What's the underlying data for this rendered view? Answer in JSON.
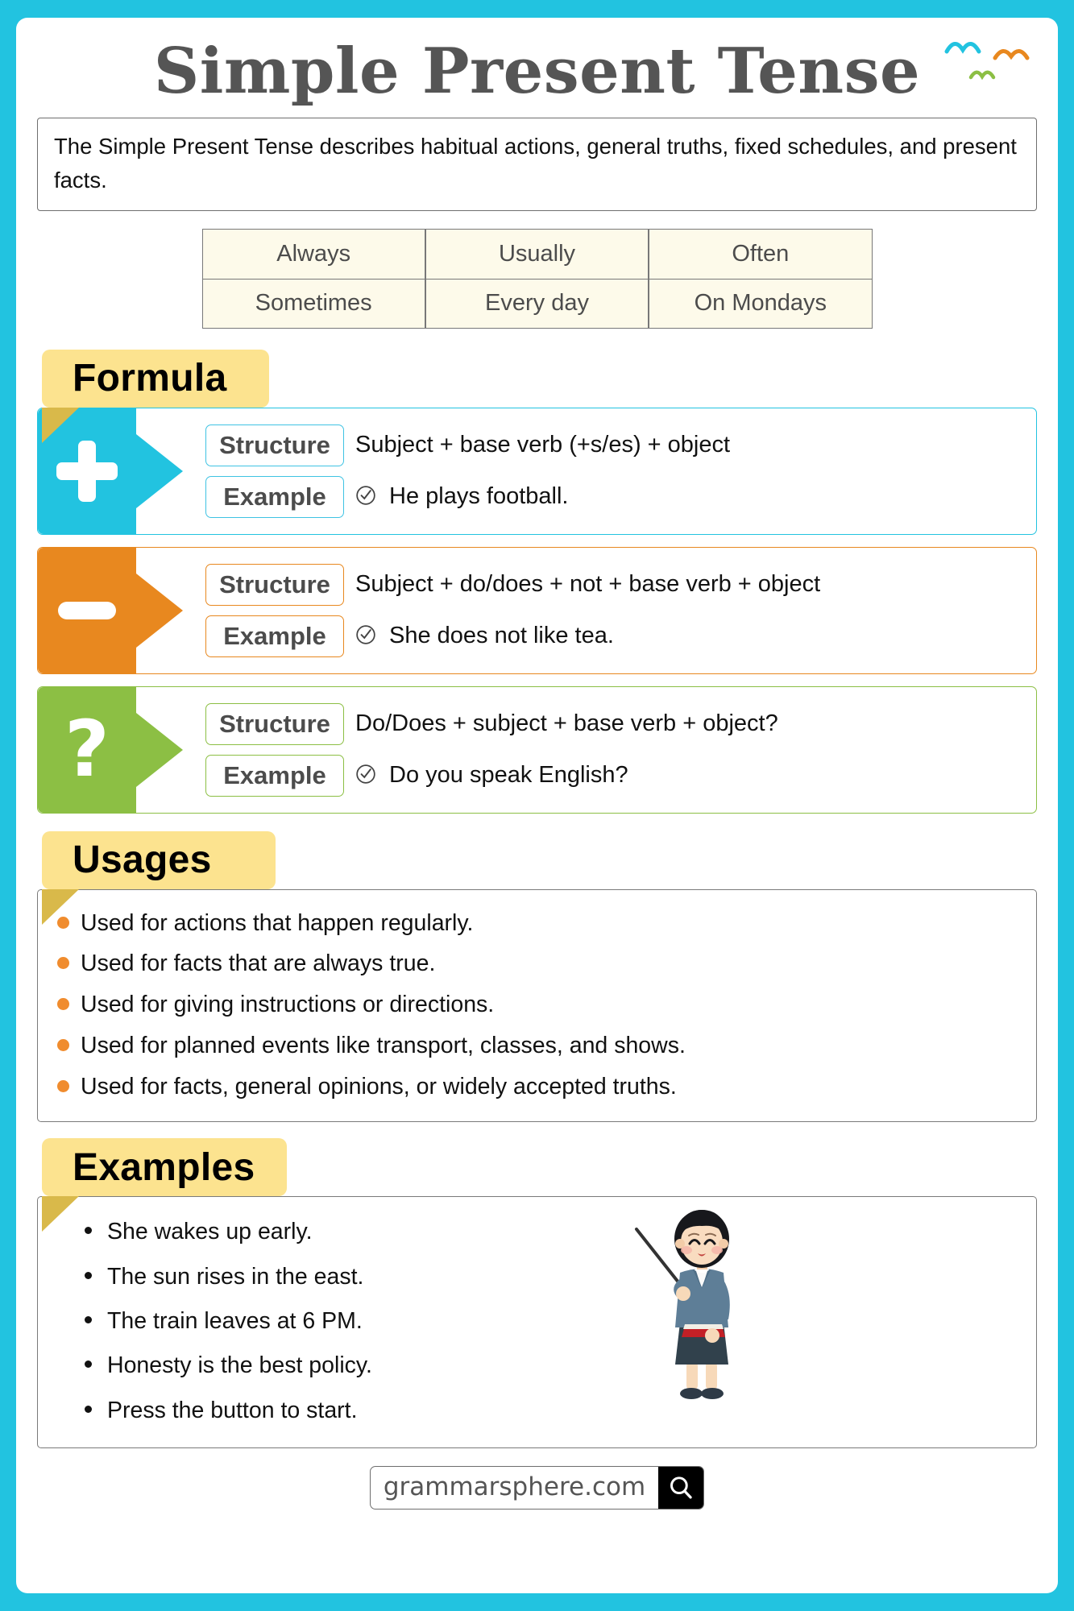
{
  "page": {
    "title": "Simple Present Tense",
    "intro": "The Simple Present Tense describes habitual actions, general truths, fixed schedules, and present facts.",
    "background_color": "#22C3E0",
    "sheet_color": "#FFFFFF"
  },
  "decor": {
    "birds": [
      {
        "name": "bird-cyan",
        "color": "#22C3E0"
      },
      {
        "name": "bird-orange",
        "color": "#E8881F"
      },
      {
        "name": "bird-green",
        "color": "#8CBF44"
      }
    ]
  },
  "adverb_table": {
    "cell_bg": "#FDFAEA",
    "rows": [
      [
        "Always",
        "Usually",
        "Often"
      ],
      [
        "Sometimes",
        "Every day",
        "On Mondays"
      ]
    ]
  },
  "sections": {
    "formula": {
      "banner": "Formula",
      "banner_color": "#FCE38F",
      "fold_color": "#D9B94A",
      "labels": {
        "structure": "Structure",
        "example": "Example"
      },
      "rows": [
        {
          "key": "positive",
          "sign": "plus-icon",
          "color": "#22C3E0",
          "structure": "Subject + base verb (+s/es) + object",
          "example": "He plays football."
        },
        {
          "key": "negative",
          "sign": "minus-icon",
          "color": "#E8881F",
          "structure": "Subject + do/does + not + base verb + object",
          "example": "She does not like tea."
        },
        {
          "key": "question",
          "sign": "question-mark-icon",
          "color": "#8CBF44",
          "structure": "Do/Does + subject + base verb + object?",
          "example": "Do you speak English?"
        }
      ]
    },
    "usages": {
      "banner": "Usages",
      "bullet_color": "#F08C2E",
      "items": [
        "Used for actions that happen regularly.",
        "Used for facts that are always true.",
        "Used for giving instructions or directions.",
        "Used for planned events like transport, classes, and shows.",
        "Used for facts, general opinions, or widely accepted truths."
      ]
    },
    "examples": {
      "banner": "Examples",
      "items": [
        "She wakes up early.",
        "The sun rises in the east.",
        "The train leaves at 6 PM.",
        "Honesty is the best policy.",
        "Press the button to start."
      ],
      "illustration": "teacher-with-pointer-illustration"
    }
  },
  "footer": {
    "url": "grammarsphere.com",
    "search_icon": "magnifier-icon",
    "button_color": "#000000"
  }
}
